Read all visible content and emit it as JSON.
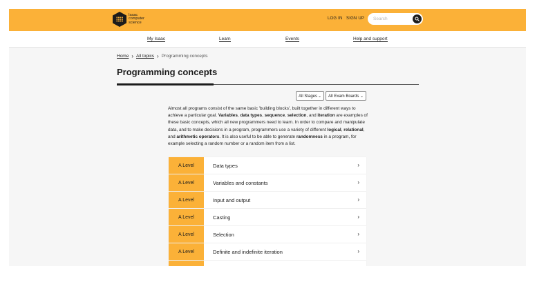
{
  "header": {
    "logo_lines": [
      "Isaac",
      "computer",
      "science"
    ],
    "login": "LOG IN",
    "signup": "SIGN UP",
    "search_placeholder": "Search"
  },
  "nav": [
    "My Isaac",
    "Learn",
    "Events",
    "Help and support"
  ],
  "breadcrumb": {
    "home": "Home",
    "all_topics": "All topics",
    "current": "Programming concepts"
  },
  "page": {
    "title": "Programming concepts",
    "stage_filter": "All Stages",
    "board_filter": "All Exam Boards",
    "intro": [
      {
        "t": "Almost all programs consist of the same basic 'building blocks', built together in different ways to achieve a particular goal. ",
        "b": false
      },
      {
        "t": "Variables",
        "b": true
      },
      {
        "t": ", ",
        "b": false
      },
      {
        "t": "data types",
        "b": true
      },
      {
        "t": ", ",
        "b": false
      },
      {
        "t": "sequence",
        "b": true
      },
      {
        "t": ", ",
        "b": false
      },
      {
        "t": "selection",
        "b": true
      },
      {
        "t": ", and ",
        "b": false
      },
      {
        "t": "iteration",
        "b": true
      },
      {
        "t": " are examples of these basic concepts, which all new programmers need to learn. In order to compare and manipulate data, and to make decisions in a program, programmers use a variety of different ",
        "b": false
      },
      {
        "t": "logical",
        "b": true
      },
      {
        "t": ", ",
        "b": false
      },
      {
        "t": "relational",
        "b": true
      },
      {
        "t": ", and ",
        "b": false
      },
      {
        "t": "arithmetic operators",
        "b": true
      },
      {
        "t": ". It is also useful to be able to generate ",
        "b": false
      },
      {
        "t": "randomness",
        "b": true
      },
      {
        "t": " in a program, for example selecting a random number or a random item from a list.",
        "b": false
      }
    ]
  },
  "topics": [
    {
      "level": "A Level",
      "label": "Data types"
    },
    {
      "level": "A Level",
      "label": "Variables and constants"
    },
    {
      "level": "A Level",
      "label": "Input and output"
    },
    {
      "level": "A Level",
      "label": "Casting"
    },
    {
      "level": "A Level",
      "label": "Selection"
    },
    {
      "level": "A Level",
      "label": "Definite and indefinite iteration"
    },
    {
      "level": "",
      "label": ""
    }
  ],
  "colors": {
    "accent": "#fbb138",
    "dark": "#1c1c1c"
  }
}
